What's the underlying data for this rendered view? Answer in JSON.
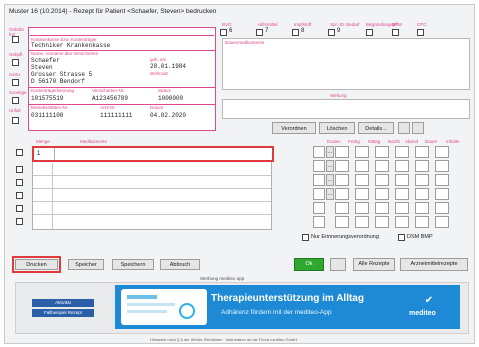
{
  "window": {
    "title": "Muster 16 (10.2014) - Rezept für Patient <Schaefer, Steven> bedrucken"
  },
  "side_labels": [
    "Gebühr frei",
    "Gebpfl.",
    "noctu",
    "Sonstige",
    "Unfall",
    "Arbeits-unfall"
  ],
  "top_checks": [
    {
      "top": "BVG",
      "num": "6"
    },
    {
      "top": "Hilfsmittel",
      "num": "7"
    },
    {
      "top": "Impfstoff",
      "num": "8"
    },
    {
      "top": "Spr.-St. Bedarf",
      "num": "9"
    },
    {
      "top": "Begründungspfl.",
      "num": ""
    },
    {
      "top": "BPM",
      "num": ""
    },
    {
      "top": "OTC",
      "num": ""
    }
  ],
  "patient": {
    "insurer_label": "Krankenkasse bzw. Kostenträger",
    "insurer": "Techniker Krankenkasse",
    "name_label": "Name, Vorname des Versicherten",
    "last_name": "Schaefer",
    "first_name": "Steven",
    "dob_label": "geb. am",
    "dob": "28.01.1984",
    "street": "Grosser Strasse 5",
    "city": "D 56170 Bendorf",
    "status_label": "Wohnsitz",
    "insurer_no_label": "Kostenträgerkennung",
    "insurer_no": "101575519",
    "insured_no_label": "Versicherten-Nr.",
    "insured_no": "A123456789",
    "status_code_label": "Status",
    "status_code": "1000000",
    "bsnr_label": "Betriebsstätten-Nr.",
    "bsnr": "031111100",
    "lanr_label": "Arzt-Nr.",
    "lanr": "111111111",
    "date_label": "Datum",
    "date": "04.02.2020"
  },
  "panels": {
    "dauermedikamente": "Dauermedikamente",
    "wirkung": "Wirkung"
  },
  "mid_buttons": [
    "Verordnen",
    "Löschen",
    "Details..."
  ],
  "meds": {
    "menge_label": "Menge",
    "medikament_label": "Medikamente",
    "first_qty": "1",
    "columns": [
      "Dosier.",
      "Frühg.",
      "Mittag",
      "Nacht",
      "Abend",
      "Dauer",
      "Inhalte"
    ],
    "add_button": "...",
    "erinnerung": "Nur Erinnerungsverordnung",
    "dsm": "DSM BMP"
  },
  "bottom_buttons": [
    "Drucken",
    "Speicher",
    "Speichern",
    "Abbruch"
  ],
  "right_buttons": {
    "green": "Ok",
    "alle": "Alle Rezepte",
    "arznei": "Arzneimittelrezepte"
  },
  "ad": {
    "header": "Werbung mediteo app",
    "btn1": "Aktivität",
    "btn2": "Fallbeispiel Rezept",
    "headline": "Therapieunterstützung im Alltag",
    "subline": "Adhärenz fördern mit der mediteo-App",
    "brand": "mediteo",
    "footer": "Hinweise nach § 6 der Werbe-Richtlinien · Information an die Firma mediteo GmbH"
  },
  "colors": {
    "pink": "#e0498d",
    "red": "#e03a3a",
    "adblue": "#1e8ad6",
    "green": "#2fa82f"
  }
}
